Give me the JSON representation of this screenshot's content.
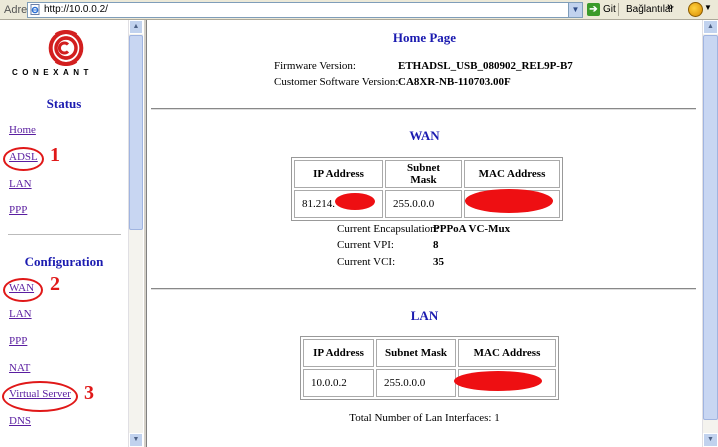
{
  "browser": {
    "address_label": "Adres",
    "url": "http://10.0.0.2/",
    "go_label": "Git",
    "links_label": "Bağlantılar",
    "overflow": "»"
  },
  "sidebar": {
    "logo_text": "CONEXANT",
    "status_title": "Status",
    "status_links": [
      "Home",
      "ADSL",
      "LAN",
      "PPP"
    ],
    "config_title": "Configuration",
    "config_links": [
      "WAN",
      "LAN",
      "PPP",
      "NAT",
      "Virtual Server",
      "DNS"
    ],
    "annotations": [
      "1",
      "2",
      "3"
    ]
  },
  "main": {
    "title": "Home Page",
    "firmware_label": "Firmware Version:",
    "firmware_value": "ETHADSL_USB_080902_REL9P-B7",
    "customer_label": "Customer Software Version:",
    "customer_value": "CA8XR-NB-110703.00F",
    "wan": {
      "title": "WAN",
      "headers": [
        "IP Address",
        "Subnet Mask",
        "MAC Address"
      ],
      "ip": "81.214.",
      "mask": "255.0.0.0",
      "mac": "",
      "encap_label": "Current Encapsulation:",
      "encap_value": "PPPoA VC-Mux",
      "vpi_label": "Current VPI:",
      "vpi_value": "8",
      "vci_label": "Current VCI:",
      "vci_value": "35"
    },
    "lan": {
      "title": "LAN",
      "headers": [
        "IP Address",
        "Subnet Mask",
        "MAC Address"
      ],
      "ip": "10.0.0.2",
      "mask": "255.0.0.0",
      "mac": "",
      "interfaces_label": "Total Number of Lan Interfaces:",
      "interfaces_value": "1"
    }
  },
  "colors": {
    "heading": "#1b1bb0",
    "link": "#5a1ea0",
    "annotation": "#e01818",
    "redaction": "#ee0f12"
  }
}
